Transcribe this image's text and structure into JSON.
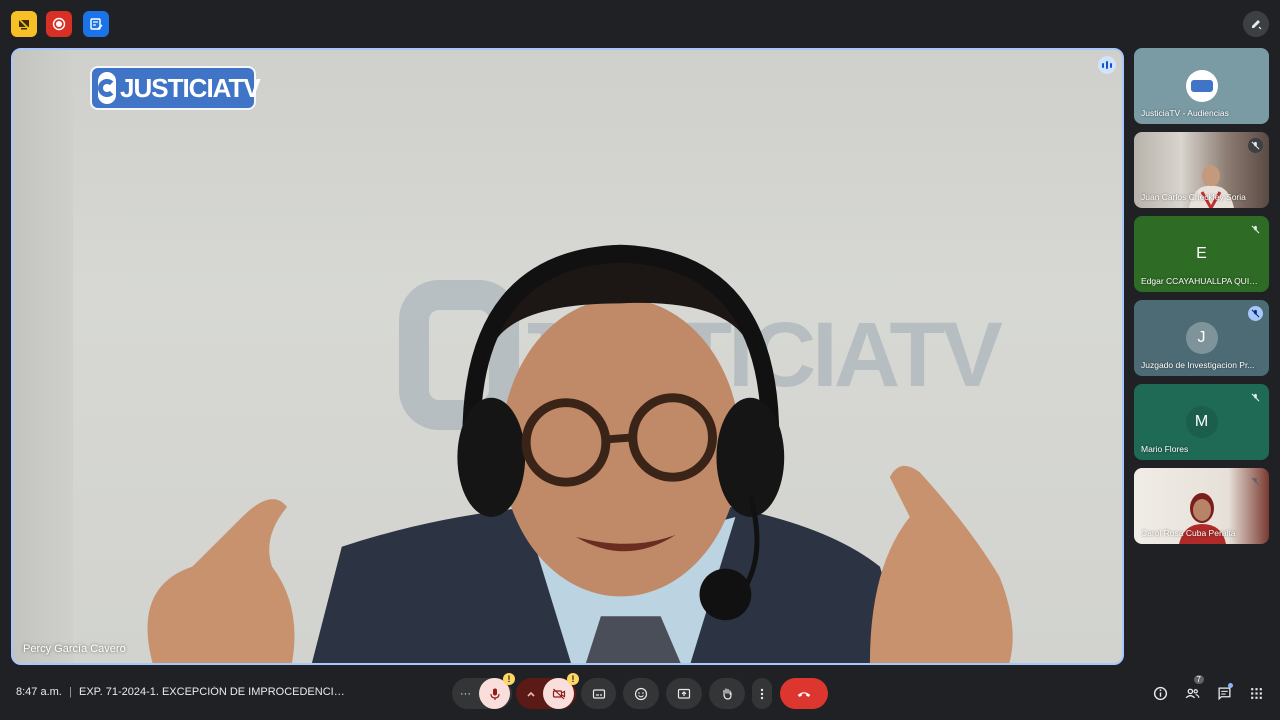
{
  "main": {
    "speaker_name": "Percy García Cavero",
    "logo_text": "JUSTICIATV",
    "watermark_text": "JUSTICIATV"
  },
  "participants": [
    {
      "name": "JusticiaTV - Audiencias",
      "type": "logo",
      "muted": false,
      "bg": "#7a9ba4"
    },
    {
      "name": "Juan Carlos Checkley Soria",
      "type": "video",
      "muted": true,
      "bg": "#8d8a84"
    },
    {
      "name": "Edgar CCAYAHUALLPA QUIS...",
      "type": "avatar",
      "initial": "E",
      "muted": true,
      "bg": "#2e6b24",
      "avatar_bg": "#2e6b24"
    },
    {
      "name": "Juzgado de Investigacion Pr...",
      "type": "avatar",
      "initial": "J",
      "muted": true,
      "bg": "#4d6b75",
      "avatar_bg": "#7f939a"
    },
    {
      "name": "Mario Flores",
      "type": "avatar",
      "initial": "M",
      "muted": true,
      "bg": "#1f6a55",
      "avatar_bg": "#1b5e4b"
    },
    {
      "name": "Carol Rosa Cuba Peralta",
      "type": "video",
      "muted": true,
      "bg": "#e9e4de"
    }
  ],
  "bottom": {
    "time": "8:47 a.m.",
    "separator": "|",
    "meeting_title": "EXP. 71-2024-1. EXCEPCIÓN DE IMPROCEDENCIA D...",
    "more_label": "···",
    "warn_mark": "!",
    "people_count": "7"
  },
  "colors": {
    "accent_border": "#a8c7fa",
    "hangup": "#dc362e",
    "mic_off_bg": "#f9dedc",
    "topbar_yellow": "#f6c026",
    "topbar_red": "#d93025",
    "topbar_blue": "#1a73e8"
  },
  "icons": [
    "screen-share-off-icon",
    "record-icon",
    "notes-icon",
    "pen-icon",
    "speaking-icon",
    "mic-off-icon",
    "chevron-up-icon",
    "camera-off-icon",
    "captions-icon",
    "emoji-icon",
    "present-icon",
    "raise-hand-icon",
    "more-vert-icon",
    "hangup-icon",
    "info-icon",
    "people-icon",
    "chat-icon",
    "apps-icon"
  ]
}
